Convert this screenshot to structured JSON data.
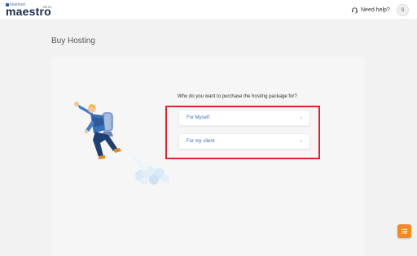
{
  "header": {
    "brand_small": "bluehost",
    "brand_main": "maestro",
    "brand_tag": "BETA",
    "help_label": "Need help?",
    "avatar_initial": "S"
  },
  "page": {
    "title": "Buy Hosting"
  },
  "purchase": {
    "question": "Who do you want to purchase the hosting package for?",
    "options": [
      {
        "label": "For Myself",
        "icon": "chevron-right-icon"
      },
      {
        "label": "For my client",
        "icon": "chevron-right-icon"
      }
    ]
  },
  "colors": {
    "highlight": "#d9262c",
    "accent": "#3d6db5",
    "fab": "#f08a24"
  },
  "icons": {
    "help": "headset-icon",
    "fab": "list-icon"
  }
}
